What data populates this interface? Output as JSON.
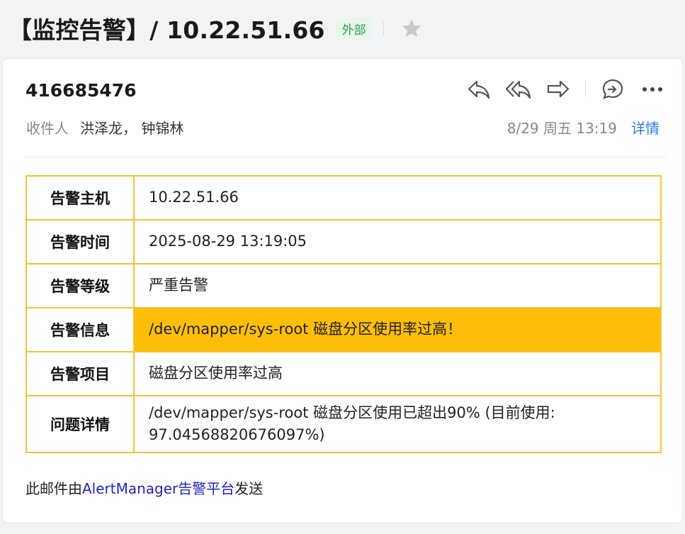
{
  "subject": {
    "title": "【监控告警】/ 10.22.51.66",
    "badge": "外部",
    "star_icon": "star-icon"
  },
  "mail": {
    "sender": "416685476",
    "recipients_label": "收件人",
    "recipients": "洪泽龙， 钟锦林",
    "time": "8/29 周五 13:19",
    "detail_label": "详情",
    "actions": [
      "reply-icon",
      "reply-all-icon",
      "forward-icon",
      "chat-icon",
      "more-icon"
    ]
  },
  "alert_table": [
    {
      "label": "告警主机",
      "value": "10.22.51.66"
    },
    {
      "label": "告警时间",
      "value": "2025-08-29 13:19:05"
    },
    {
      "label": "告警等级",
      "value": "严重告警"
    },
    {
      "label": "告警信息",
      "value": "/dev/mapper/sys-root 磁盘分区使用率过高！"
    },
    {
      "label": "告警项目",
      "value": "磁盘分区使用率过高"
    },
    {
      "label": "问题详情",
      "value": "/dev/mapper/sys-root 磁盘分区使用已超出90% (目前使用: 97.04568820676097%)"
    }
  ],
  "footer": {
    "prefix": "此邮件由",
    "link": "AlertManager告警平台",
    "suffix": "发送"
  },
  "colors": {
    "table_border": "#f7c331",
    "highlight_row": "#fdbe0a",
    "badge_bg": "#e6f6ea",
    "badge_text": "#2ba24c",
    "detail_link": "#2f7de1",
    "footer_link": "#2222cc"
  }
}
